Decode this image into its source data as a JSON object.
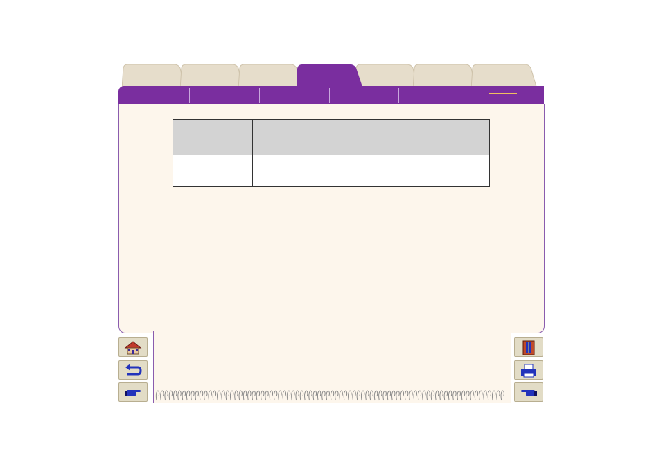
{
  "tabs": [
    {
      "label": "",
      "active": false
    },
    {
      "label": "",
      "active": false
    },
    {
      "label": "",
      "active": false
    },
    {
      "label": "",
      "active": true
    },
    {
      "label": "",
      "active": false
    },
    {
      "label": "",
      "active": false
    },
    {
      "label": "",
      "active": false
    }
  ],
  "nav_segments": [
    "",
    "",
    "",
    "",
    "",
    ""
  ],
  "table": {
    "headers": [
      "",
      "",
      ""
    ],
    "rows": [
      [
        "",
        "",
        ""
      ]
    ]
  },
  "buttons_left": {
    "home": "home-icon",
    "back": "back-arrow-icon",
    "next": "pointing-hand-right-icon"
  },
  "buttons_right": {
    "contents": "book-icon",
    "print": "printer-icon",
    "prev": "pointing-hand-left-icon"
  },
  "colors": {
    "accent": "#7a2e9f",
    "panel": "#fdf6ec",
    "tab_inactive": "#e6ddcb",
    "table_header": "#d3d3d3",
    "button": "#e2dcc6"
  }
}
